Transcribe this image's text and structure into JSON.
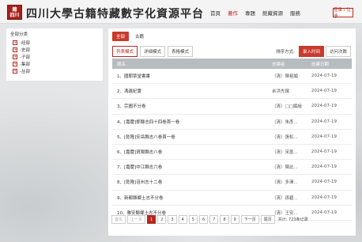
{
  "header": {
    "logo_text": "籍\n四川",
    "site_title": "四川大學古籍特藏數字化資源平台",
    "nav": [
      "首頁",
      "著作",
      "專題",
      "館藏資源",
      "服務"
    ],
    "nav_active_index": 1,
    "login_label": "登录 / 注册"
  },
  "tree": {
    "root_label": "全部分类",
    "items": [
      "经部",
      "史部",
      "子部",
      "集部",
      "丛部"
    ]
  },
  "tabs": [
    "全部",
    "古籍"
  ],
  "tabs_active_index": 0,
  "view_modes": [
    "列表模式",
    "详细模式",
    "表格模式"
  ],
  "view_mode_active_index": 0,
  "sort": {
    "label": "排序方式:",
    "options": [
      "录入时间",
      "访问次数"
    ],
    "active_index": 0
  },
  "table": {
    "headers": {
      "name": "题名",
      "author": "创建者",
      "date": "创建日期"
    },
    "rows": [
      {
        "name": "1、國朝草堂書書",
        "author": "（清）陳祖編",
        "date": "2024-07-19"
      },
      {
        "name": "2、馮遺紀實",
        "author": "余洪先撰",
        "date": "2024-07-19"
      },
      {
        "name": "3、宗圖不分卷",
        "author": "（清）□□編繪",
        "date": "2024-07-19"
      },
      {
        "name": "4、[嘉慶]邯縣志四十四卷首一卷",
        "author": "（清）朱彥...",
        "date": "2024-07-19"
      },
      {
        "name": "5、[乾隆]安岳縣志八卷首一卷",
        "author": "（清）張松...",
        "date": "2024-07-19"
      },
      {
        "name": "6、[嘉慶]資陽縣志八卷",
        "author": "（清）宋墨...",
        "date": "2024-07-19"
      },
      {
        "name": "7、[嘉慶]中江縣志六卷",
        "author": "（清）陳此...",
        "date": "2024-07-19"
      },
      {
        "name": "8、[乾隆]涪州志十二卷",
        "author": "（清）多澤...",
        "date": "2024-07-19"
      },
      {
        "name": "9、新都縣鄉土志不分卷",
        "author": "（清）孫碧...",
        "date": "2024-07-19"
      },
      {
        "name": "10、雅安縣鄉土志不分卷",
        "author": "（清）王安...",
        "date": "2024-07-19"
      }
    ]
  },
  "pager": {
    "first": "首页",
    "prev": "上一页",
    "pages": [
      "1",
      "2",
      "3",
      "4",
      "5",
      "6",
      "7",
      "8",
      "9"
    ],
    "current_index": 0,
    "next": "下一页",
    "last": "尾页",
    "total": "共计: 723条记录"
  },
  "colors": {
    "accent": "#b8271f",
    "header_row": "#b7bcc0"
  }
}
